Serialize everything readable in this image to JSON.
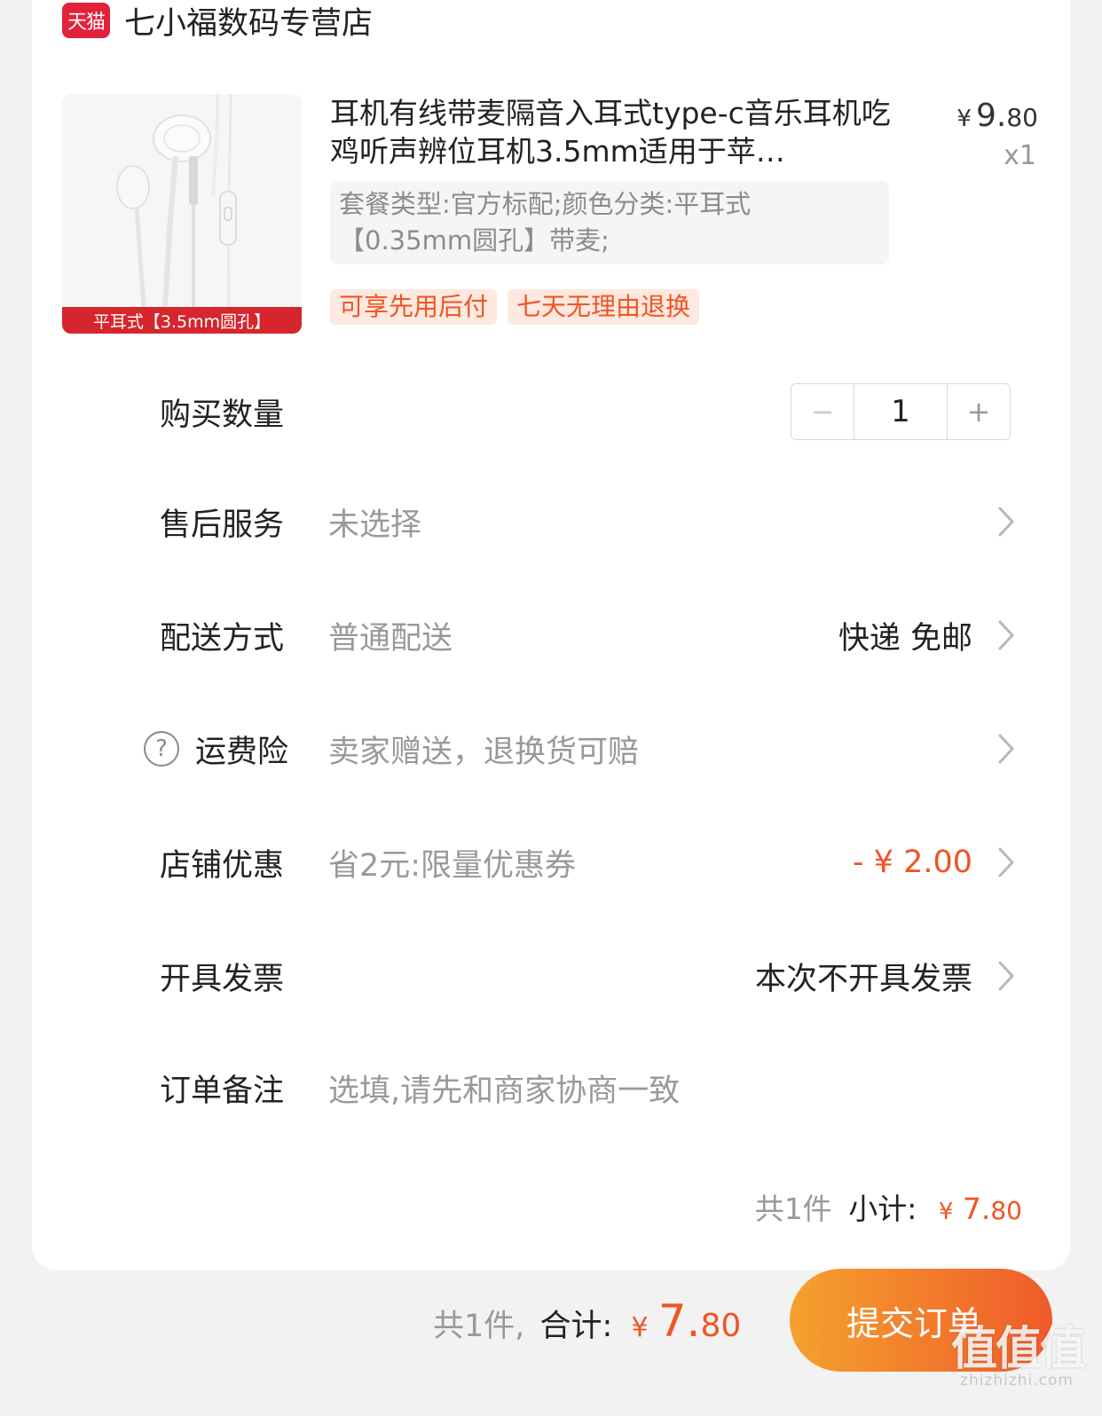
{
  "store": {
    "badge": "天猫",
    "name": "七小福数码专营店"
  },
  "product": {
    "image_caption": "平耳式【3.5mm圆孔】",
    "title": "耳机有线带麦隔音入耳式type-c音乐耳机吃鸡听声辨位耳机3.5mm适用于苹…",
    "price_currency": "¥",
    "price_int": "9.",
    "price_dec": "80",
    "quantity": "x1",
    "spec": "套餐类型:官方标配;颜色分类:平耳式【0.35mm圆孔】带麦;",
    "tags": [
      "可享先用后付",
      "七天无理由退换"
    ]
  },
  "rows": {
    "quantity": {
      "label": "购买数量",
      "minus": "−",
      "value": "1",
      "plus": "+"
    },
    "after_sales": {
      "label": "售后服务",
      "value": "未选择"
    },
    "delivery": {
      "label": "配送方式",
      "value": "普通配送",
      "right": "快递 免邮"
    },
    "shipping_insurance": {
      "label": "运费险",
      "help": "?",
      "value": "卖家赠送，退换货可赔"
    },
    "store_discount": {
      "label": "店铺优惠",
      "value": "省2元:限量优惠券",
      "right": "- ¥ 2.00"
    },
    "invoice": {
      "label": "开具发票",
      "right": "本次不开具发票"
    },
    "note": {
      "label": "订单备注",
      "placeholder": "选填,请先和商家协商一致"
    }
  },
  "subtotal": {
    "count": "共1件",
    "label": "小计:",
    "currency": "¥",
    "int": "7.",
    "dec": "80"
  },
  "footer": {
    "count": "共1件,",
    "label": "合计:",
    "currency": "¥",
    "int": "7.",
    "dec": "80",
    "submit": "提交订单"
  },
  "watermark": {
    "logo": "值值值",
    "url": "zhizhizhi.com"
  },
  "colors": {
    "accent": "#f05423",
    "tmall_red": "#e4213b",
    "button_gradient_start": "#f5a12e",
    "button_gradient_end": "#ef5b2a"
  }
}
